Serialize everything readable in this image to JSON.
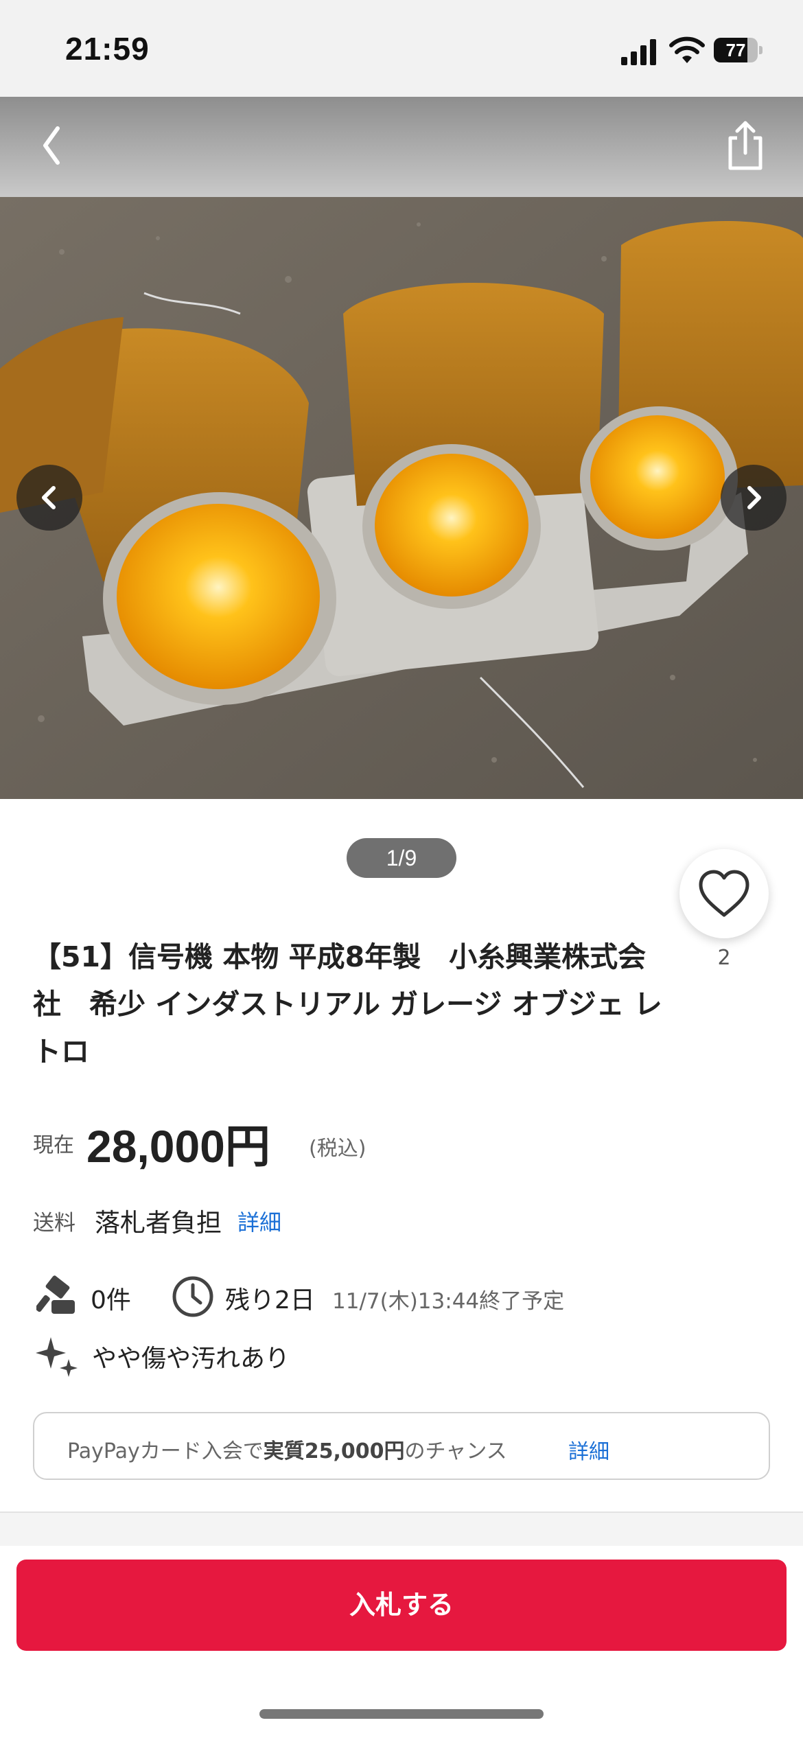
{
  "status_bar": {
    "time": "21:59",
    "battery": "77",
    "battery_level": 0.77
  },
  "nav": {
    "back_icon": "chevron-left-icon",
    "share_icon": "share-icon"
  },
  "gallery": {
    "counter": "1/9",
    "prev_icon": "chevron-left-icon",
    "next_icon": "chevron-right-icon",
    "image_alt": "traffic signal with three lit amber lamps"
  },
  "favorite": {
    "icon": "heart-icon",
    "count": "2"
  },
  "title": "【51】信号機 本物 平成8年製　小糸興業株式会社　希少 インダストリアル ガレージ オブジェ レトロ",
  "price": {
    "label": "現在",
    "amount": "28,000",
    "currency": "円",
    "tax_note": "(税込)"
  },
  "shipping": {
    "label": "送料",
    "value": "落札者負担",
    "detail_link": "詳細"
  },
  "stats": {
    "bids": "0件",
    "remaining": "残り2日",
    "end_time": "11/7(木)13:44終了予定",
    "condition": "やや傷や汚れあり"
  },
  "paypay": {
    "prefix": "PayPayカード入会で",
    "highlight": "実質25,000円",
    "suffix": "のチャンス",
    "detail_link": "詳細"
  },
  "bid_button": {
    "label": "入札する"
  },
  "colors": {
    "accent_red": "#e6183f",
    "link_blue": "#1a6fd6",
    "lamp_amber": "#f5a400"
  }
}
